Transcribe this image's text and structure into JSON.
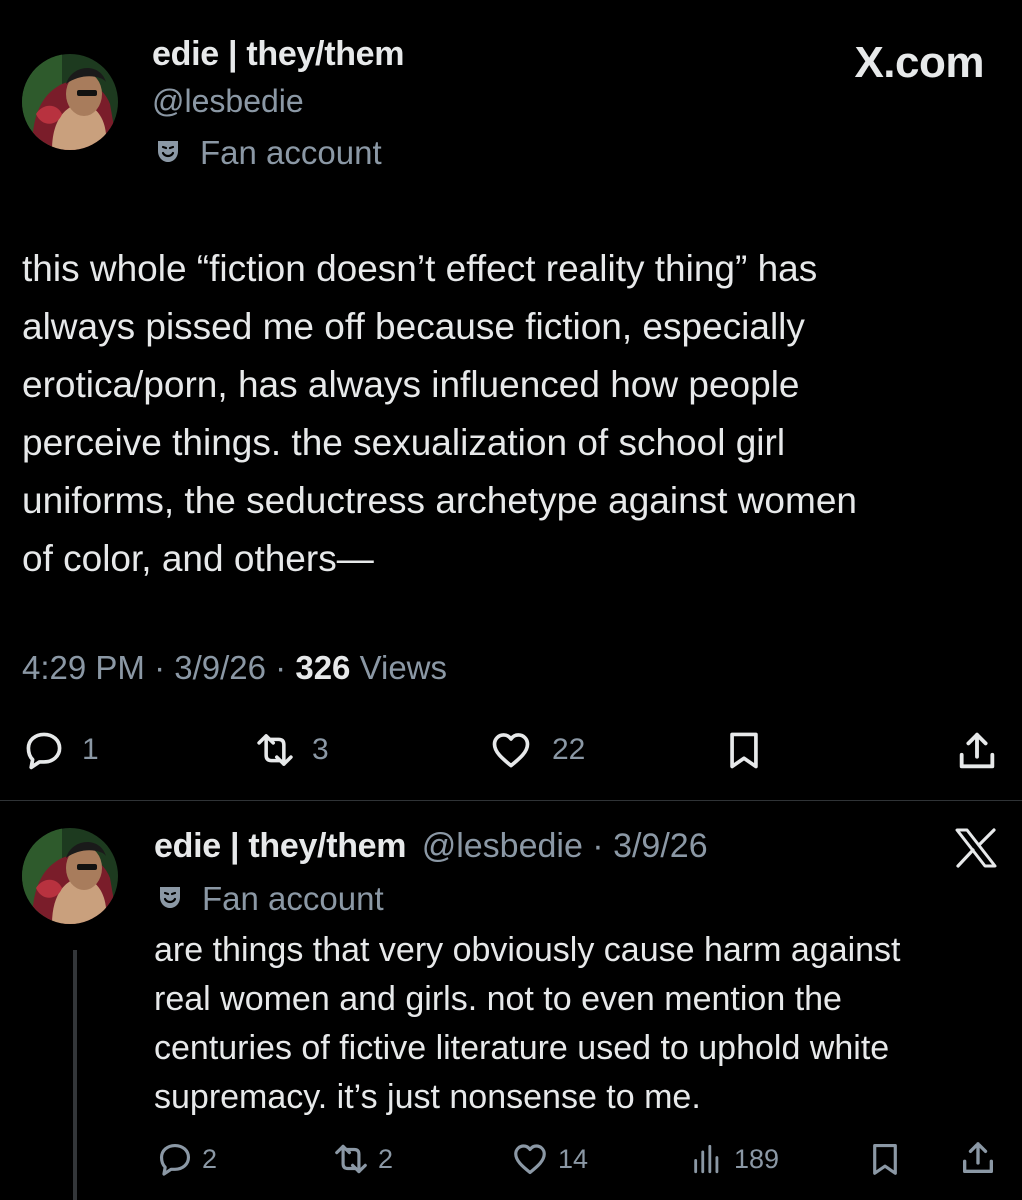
{
  "brand": {
    "label": "X.com"
  },
  "tweet1": {
    "display_name": "edie | they/them",
    "handle": "@lesbedie",
    "badge_label": "Fan account",
    "body": "this whole “fiction doesn’t effect reality thing” has\nalways pissed me off because fiction, especially\nerotica/porn, has always influenced how people\nperceive things. the sexualization of school girl\nuniforms, the seductress archetype against women\nof color, and others—",
    "meta": {
      "time": "4:29 PM",
      "sep1": "·",
      "date": "3/9/26",
      "sep2": "·",
      "views_count": "326",
      "views_label": "Views"
    },
    "actions": {
      "replies": "1",
      "reposts": "3",
      "likes": "22"
    }
  },
  "tweet2": {
    "display_name": "edie | they/them",
    "handle_date": "@lesbedie · 3/9/26",
    "badge_label": "Fan account",
    "body": "are things that very obviously cause harm against\nreal women and girls. not to even mention the\ncenturies of fictive literature used to uphold white\nsupremacy. it’s just nonsense to me.",
    "actions": {
      "replies": "2",
      "reposts": "2",
      "likes": "14",
      "views": "189"
    }
  },
  "icons": {
    "badge": "theater-masks-icon",
    "reply": "speech-bubble-icon",
    "repost": "repost-arrows-icon",
    "like": "heart-icon",
    "bookmark": "bookmark-icon",
    "share": "share-icon",
    "views": "bar-chart-icon",
    "x_logo": "x-logo-icon"
  },
  "colors": {
    "background": "#000000",
    "text_primary": "#e7e9ea",
    "text_secondary": "#8b98a5",
    "divider": "#2f3336"
  }
}
